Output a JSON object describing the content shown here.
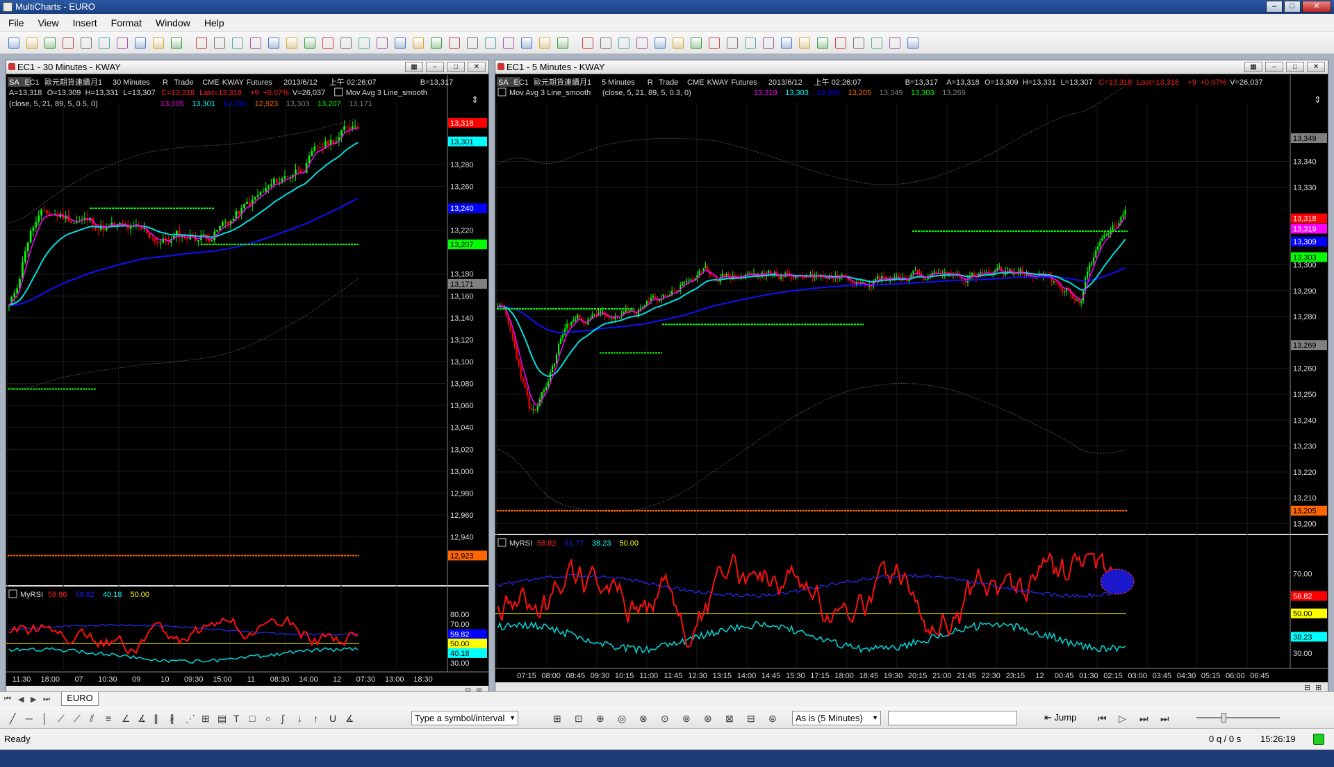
{
  "app": {
    "title": "MultiCharts - EURO"
  },
  "window_buttons": {
    "minimize": "–",
    "maximize": "□",
    "close": "✕"
  },
  "menu": [
    "File",
    "View",
    "Insert",
    "Format",
    "Window",
    "Help"
  ],
  "left_chart": {
    "window_title": "EC1 - 30 Minutes - KWAY",
    "info_line": [
      "SA",
      "EC1",
      "歐元期貨連續月1",
      "30 Minutes",
      "R",
      "Trade",
      "CME",
      "KWAY",
      "Futures",
      "2013/6/12",
      "上午 02:26:07",
      "B=13,317"
    ],
    "ohlc_line": {
      "a": "A=13,318",
      "o": "O=13,309",
      "h": "H=13,331",
      "l": "L=13,307",
      "c": "C=13,318",
      "last": "Last=13,318",
      "chg": "+9",
      "pct": "+0.07%",
      "v": "V=26,037"
    },
    "indicator_name": "Mov Avg 3 Line_smooth",
    "indicator_params": "(close,  5,  21,  89,  5,  0.5,  0)",
    "indicator_values": [
      "13,305",
      "13,301",
      "13,231",
      "12,923",
      "13,303",
      "13,207",
      "13,171"
    ],
    "price_axis": [
      "13,280",
      "13,260",
      "13,220",
      "13,180",
      "13,160",
      "13,140",
      "13,120",
      "13,100",
      "13,080",
      "13,060",
      "13,040",
      "13,020",
      "13,000",
      "12,980",
      "12,960",
      "12,940"
    ],
    "price_tags": [
      {
        "text": "13,318",
        "bg": "#ff0000",
        "fg": "#ffffff",
        "v": 13318
      },
      {
        "text": "13,301",
        "bg": "#00ffff",
        "fg": "#000000",
        "v": 13301
      },
      {
        "text": "13,240",
        "bg": "#0000ff",
        "fg": "#ffffff",
        "v": 13240
      },
      {
        "text": "13,207",
        "bg": "#00ff00",
        "fg": "#000000",
        "v": 13207
      },
      {
        "text": "13,171",
        "bg": "#808080",
        "fg": "#000000",
        "v": 13171
      },
      {
        "text": "12,923",
        "bg": "#ff6600",
        "fg": "#000000",
        "v": 12923
      }
    ],
    "rsi": {
      "name": "MyRSI",
      "values": [
        "59.96",
        "59.82",
        "40.18",
        "50.00"
      ],
      "axis": [
        "80.00",
        "70.00",
        "30.00"
      ],
      "tags": [
        {
          "text": "59.82",
          "bg": "#0000ff",
          "fg": "#ffffff",
          "v": 59.82
        },
        {
          "text": "50.00",
          "bg": "#ffff00",
          "fg": "#000000",
          "v": 50
        },
        {
          "text": "40.18",
          "bg": "#00ffff",
          "fg": "#000000",
          "v": 40.18
        }
      ]
    },
    "time_axis": [
      "11:30",
      "18:00",
      "07",
      "10:30",
      "09",
      "10",
      "09:30",
      "15:00",
      "11",
      "08:30",
      "14:00",
      "12",
      "07:30",
      "13:00",
      "18:30"
    ]
  },
  "right_chart": {
    "window_title": "EC1 - 5 Minutes - KWAY",
    "info_line": [
      "SA",
      "EC1",
      "歐元期貨連續月1",
      "5 Minutes",
      "R",
      "Trade",
      "CME",
      "KWAY",
      "Futures",
      "2013/6/12",
      "上午 02:26:07",
      "B=13,317"
    ],
    "ohlc_line": {
      "a": "A=13,318",
      "o": "O=13,309",
      "h": "H=13,331",
      "l": "L=13,307",
      "c": "C=13,318",
      "last": "Last=13,318",
      "chg": "+9",
      "pct": "+0.07%",
      "v": "V=26,037"
    },
    "indicator_name": "Mov Avg 3 Line_smooth",
    "indicator_params": "(close,  5,  21,  89,  5,  0.3,  0)",
    "indicator_values": [
      "13,319",
      "13,303",
      "13,309",
      "13,205",
      "13,349",
      "13,303",
      "13,269"
    ],
    "price_axis": [
      "13,340",
      "13,330",
      "13,300",
      "13,290",
      "13,280",
      "13,260",
      "13,250",
      "13,240",
      "13,230",
      "13,220",
      "13,210",
      "13,200"
    ],
    "price_tags": [
      {
        "text": "13,349",
        "bg": "#808080",
        "fg": "#000000",
        "v": 13349
      },
      {
        "text": "13,318",
        "bg": "#ff0000",
        "fg": "#ffffff",
        "v": 13318
      },
      {
        "text": "13,319",
        "bg": "#ff00ff",
        "fg": "#ffffff",
        "v": 13314
      },
      {
        "text": "13,309",
        "bg": "#0000ff",
        "fg": "#ffffff",
        "v": 13309
      },
      {
        "text": "13,303",
        "bg": "#00ff00",
        "fg": "#000000",
        "v": 13303
      },
      {
        "text": "13,269",
        "bg": "#808080",
        "fg": "#000000",
        "v": 13269
      },
      {
        "text": "13,205",
        "bg": "#ff6600",
        "fg": "#000000",
        "v": 13205
      }
    ],
    "rsi": {
      "name": "MyRSI",
      "values": [
        "58.82",
        "61.77",
        "38.23",
        "50.00"
      ],
      "axis": [
        "70.00",
        "30.00"
      ],
      "tags": [
        {
          "text": "58.82",
          "bg": "#ff0000",
          "fg": "#ffffff",
          "v": 58.82
        },
        {
          "text": "50.00",
          "bg": "#ffff00",
          "fg": "#000000",
          "v": 50
        },
        {
          "text": "38.23",
          "bg": "#00ffff",
          "fg": "#000000",
          "v": 38.23
        }
      ]
    },
    "time_axis": [
      "07:15",
      "08:00",
      "08:45",
      "09:30",
      "10:15",
      "11:00",
      "11:45",
      "12:30",
      "13:15",
      "14:00",
      "14:45",
      "15:30",
      "17:15",
      "18:00",
      "18:45",
      "19:30",
      "20:15",
      "21:00",
      "21:45",
      "22:30",
      "23:15",
      "12",
      "00:45",
      "01:30",
      "02:15",
      "03:00",
      "03:45",
      "04:30",
      "05:15",
      "06:00",
      "06:45"
    ]
  },
  "sheet_tab": "EURO",
  "symbol_input": {
    "value": "Type a symbol/interval"
  },
  "resolution_select": {
    "value": "As is (5 Minutes)"
  },
  "jump_label": "Jump",
  "status": {
    "left": "Ready",
    "quotes": "0 q / 0 s",
    "time": "15:26:19"
  },
  "colors": {
    "up": "#00ff00",
    "down": "#ff0000",
    "ma_fast": "#ff00ff",
    "ma_mid": "#00ffff",
    "ma_slow": "#0000ff",
    "bg": "#000000",
    "grid": "#2a2a2a"
  }
}
